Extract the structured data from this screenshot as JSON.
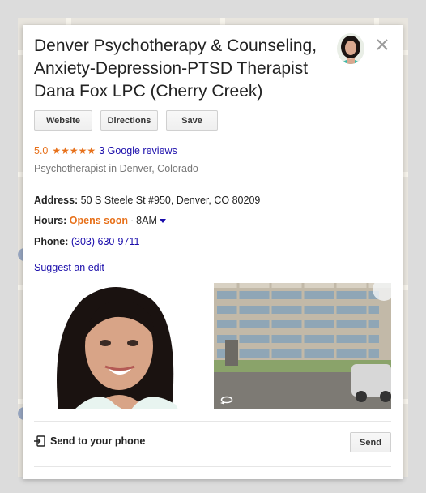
{
  "place": {
    "title_line1": "Denver Psychotherapy & Counseling,",
    "title_line2": "Anxiety-Depression-PTSD Therapist",
    "title_line3": "Dana Fox LPC (Cherry Creek)"
  },
  "actions": {
    "website_label": "Website",
    "directions_label": "Directions",
    "save_label": "Save"
  },
  "rating": {
    "score": "5.0",
    "stars": "★★★★★",
    "reviews_label": "3 Google reviews"
  },
  "category": "Psychotherapist in Denver, Colorado",
  "details": {
    "address_label": "Address:",
    "address_value": "50 S Steele St #950, Denver, CO 80209",
    "hours_label": "Hours:",
    "hours_status": "Opens soon",
    "hours_separator": "·",
    "hours_time": "8AM",
    "phone_label": "Phone:",
    "phone_value": "(303) 630-9711"
  },
  "suggest_edit_label": "Suggest an edit",
  "send": {
    "label": "Send to your phone",
    "button_label": "Send"
  },
  "colors": {
    "accent_orange": "#e7711b",
    "link_blue": "#1a0dab"
  }
}
